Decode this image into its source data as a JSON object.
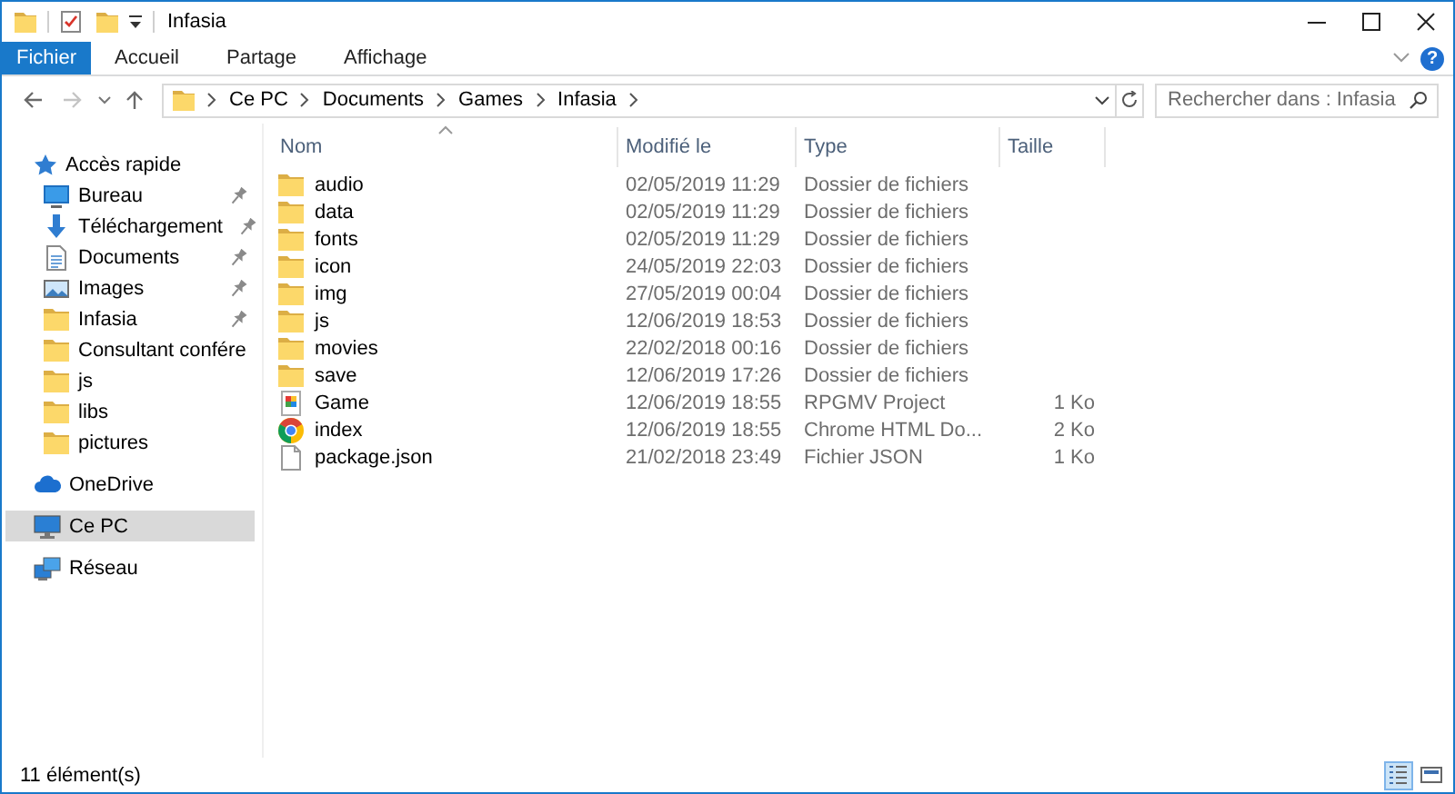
{
  "window": {
    "title": "Infasia"
  },
  "ribbon": {
    "tabs": [
      {
        "label": "Fichier",
        "kind": "file"
      },
      {
        "label": "Accueil",
        "kind": "tab"
      },
      {
        "label": "Partage",
        "kind": "tab"
      },
      {
        "label": "Affichage",
        "kind": "tab"
      }
    ],
    "help": "?"
  },
  "navigation": {
    "back": {
      "disabled": false
    },
    "forward": {
      "disabled": true
    },
    "up": {
      "disabled": false
    }
  },
  "address": {
    "path": [
      "Ce PC",
      "Documents",
      "Games",
      "Infasia"
    ]
  },
  "search": {
    "placeholder": "Rechercher dans : Infasia"
  },
  "sidebar": {
    "sections": [
      {
        "label": "Accès rapide",
        "kind": "quick_access",
        "selected": false,
        "children": [
          {
            "label": "Bureau",
            "kind": "desktop",
            "pinned": true,
            "selected": false
          },
          {
            "label": "Téléchargement",
            "kind": "download",
            "pinned": true,
            "selected": false
          },
          {
            "label": "Documents",
            "kind": "documents",
            "pinned": true,
            "selected": false
          },
          {
            "label": "Images",
            "kind": "images",
            "pinned": true,
            "selected": false
          },
          {
            "label": "Infasia",
            "kind": "folder",
            "pinned": true,
            "selected": false
          },
          {
            "label": "Consultant confére",
            "kind": "folder",
            "pinned": false,
            "selected": false
          },
          {
            "label": "js",
            "kind": "folder",
            "pinned": false,
            "selected": false
          },
          {
            "label": "libs",
            "kind": "folder",
            "pinned": false,
            "selected": false
          },
          {
            "label": "pictures",
            "kind": "folder",
            "pinned": false,
            "selected": false
          }
        ]
      },
      {
        "label": "OneDrive",
        "kind": "cloud",
        "selected": false
      },
      {
        "label": "Ce PC",
        "kind": "pc",
        "selected": true
      },
      {
        "label": "Réseau",
        "kind": "network",
        "selected": false
      }
    ]
  },
  "table": {
    "columns": [
      {
        "label": "Nom",
        "sorted": true
      },
      {
        "label": "Modifié le",
        "sorted": false
      },
      {
        "label": "Type",
        "sorted": false
      },
      {
        "label": "Taille",
        "sorted": false
      }
    ],
    "rows": [
      {
        "name": "audio",
        "kind": "folder",
        "modified": "02/05/2019 11:29",
        "type": "Dossier de fichiers"
      },
      {
        "name": "data",
        "kind": "folder",
        "modified": "02/05/2019 11:29",
        "type": "Dossier de fichiers"
      },
      {
        "name": "fonts",
        "kind": "folder",
        "modified": "02/05/2019 11:29",
        "type": "Dossier de fichiers"
      },
      {
        "name": "icon",
        "kind": "folder",
        "modified": "24/05/2019 22:03",
        "type": "Dossier de fichiers"
      },
      {
        "name": "img",
        "kind": "folder",
        "modified": "27/05/2019 00:04",
        "type": "Dossier de fichiers"
      },
      {
        "name": "js",
        "kind": "folder",
        "modified": "12/06/2019 18:53",
        "type": "Dossier de fichiers"
      },
      {
        "name": "movies",
        "kind": "folder",
        "modified": "22/02/2018 00:16",
        "type": "Dossier de fichiers"
      },
      {
        "name": "save",
        "kind": "folder",
        "modified": "12/06/2019 17:26",
        "type": "Dossier de fichiers"
      },
      {
        "name": "Game",
        "kind": "project",
        "modified": "12/06/2019 18:55",
        "type": "RPGMV Project",
        "size": "1 Ko"
      },
      {
        "name": "index",
        "kind": "browser_doc",
        "modified": "12/06/2019 18:55",
        "type": "Chrome HTML Do...",
        "size": "2 Ko"
      },
      {
        "name": "package.json",
        "kind": "file",
        "modified": "21/02/2018 23:49",
        "type": "Fichier JSON",
        "size": "1 Ko"
      }
    ]
  },
  "status_bar": {
    "text": "11 élément(s)",
    "views": [
      {
        "kind": "details",
        "selected": true
      },
      {
        "kind": "large_icons",
        "selected": false
      }
    ]
  }
}
